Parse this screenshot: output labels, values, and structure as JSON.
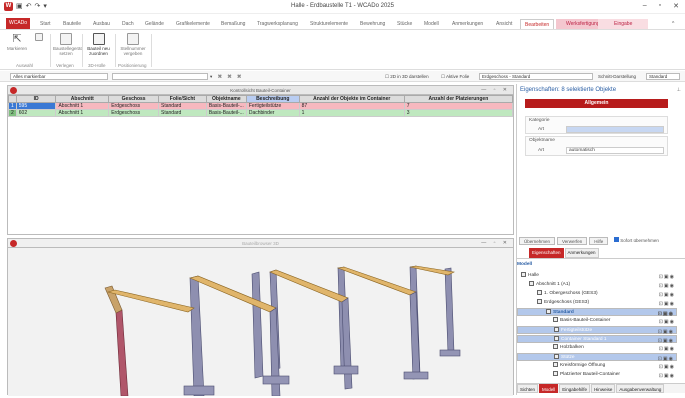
{
  "app": {
    "title": "Halle - Erdbaustelle T1 - WCADo 2025",
    "logo": "W"
  },
  "colors": {
    "accent": "#c62828",
    "selection": "#3a78d4",
    "row_red": "#f7b8bf",
    "row_green": "#bfe8bf"
  },
  "ribbon_tabs": [
    "WCADo",
    "Start",
    "Bauteile",
    "Ausbau",
    "Dach",
    "Gelände",
    "Grafikelemente",
    "Bemaßung",
    "Tragwerksplanung",
    "Strukturelemente",
    "Bewehrung",
    "Stücke",
    "Modell",
    "Anmerkungen",
    "Ansicht",
    "Bearbeiten",
    "Werksfertigung",
    "Eingabe"
  ],
  "ribbon_groups": [
    {
      "label": "Auswahl",
      "buttons": [
        "Markieren",
        ""
      ]
    },
    {
      "label": "Verlegen",
      "buttons": [
        "Baustellegerät setzen"
      ]
    },
    {
      "label": "3D-Hülle",
      "buttons": [
        "Bauteil neu zuordnen"
      ]
    },
    {
      "label": "Positionierung",
      "buttons": [
        "Stellnummer vergeben"
      ]
    }
  ],
  "filter": {
    "left_select": "Alles markierbar",
    "view_label": "2D in 3D darstellen",
    "active_label": "Aktive Folie",
    "floor_select": "Erdgeschoss - Standard",
    "section_label": "Schnitt-Darstellung",
    "section_select": "Standard"
  },
  "container": {
    "title": "Kontrollsicht Bauteil-Container",
    "columns": [
      "",
      "ID",
      "Abschnitt",
      "Geschoss",
      "Folie/Sicht",
      "Objektname",
      "Beschreibung",
      "Anzahl der Objekte im Container",
      "Anzahl der Platzierungen"
    ],
    "rows": [
      {
        "n": "1",
        "id": "595",
        "abschnitt": "Abschnitt 1",
        "geschoss": "Erdgeschoss",
        "folie": "Standard",
        "objekt": "Basis-Bauteil-...",
        "beschreibung": "Fertigteilstütze",
        "anzahl": "87",
        "platz": "7"
      },
      {
        "n": "2",
        "id": "602",
        "abschnitt": "Abschnitt 1",
        "geschoss": "Erdgeschoss",
        "folie": "Standard",
        "objekt": "Basis-Bauteil-...",
        "beschreibung": "Dachbinder",
        "anzahl": "1",
        "platz": "3"
      }
    ]
  },
  "viewport": {
    "title": "Bauteilbrowser 3D"
  },
  "properties": {
    "header": "Eigenschaften: 8 selektierte Objekte",
    "tab": "Allgemein",
    "group_kategorie": "Kategorie",
    "art_label": "Art",
    "art_value": "",
    "group_objektname": "Objektname",
    "art2_label": "Art",
    "art2_value": "automatisch",
    "buttons": [
      "Übernehmen",
      "Verwerfen",
      "Hilfe"
    ],
    "sofort": "Sofort übernehmen",
    "subtabs": [
      "Eigenschaften",
      "Anmerkungen"
    ]
  },
  "model": {
    "label": "Modell",
    "nodes": [
      {
        "text": "Halle",
        "indent": 0,
        "sel": false
      },
      {
        "text": "Abschnitt 1 (A1)",
        "indent": 1,
        "sel": false
      },
      {
        "text": "1. Obergeschoss (GES3)",
        "indent": 2,
        "sel": false
      },
      {
        "text": "Erdgeschoss (GES3)",
        "indent": 2,
        "sel": false
      },
      {
        "text": "Standard",
        "indent": 3,
        "sel": true
      },
      {
        "text": "Basis-Bauteil-Container",
        "indent": 4,
        "sel": false
      },
      {
        "text": "Fertigteilstütze",
        "indent": 4,
        "sel": true
      },
      {
        "text": "Container Standard 1",
        "indent": 4,
        "sel": true
      },
      {
        "text": "Holzbalken",
        "indent": 4,
        "sel": false
      },
      {
        "text": "Stütze",
        "indent": 4,
        "sel": true
      },
      {
        "text": "Kreisförmige Öffnung",
        "indent": 4,
        "sel": false
      },
      {
        "text": "Platzierter Bauteil-Container",
        "indent": 4,
        "sel": false
      }
    ],
    "bottom_tabs": [
      "Sichten",
      "Modell",
      "Eingabehilfe",
      "Hinweise",
      "Ausgabenverwaltung"
    ]
  }
}
